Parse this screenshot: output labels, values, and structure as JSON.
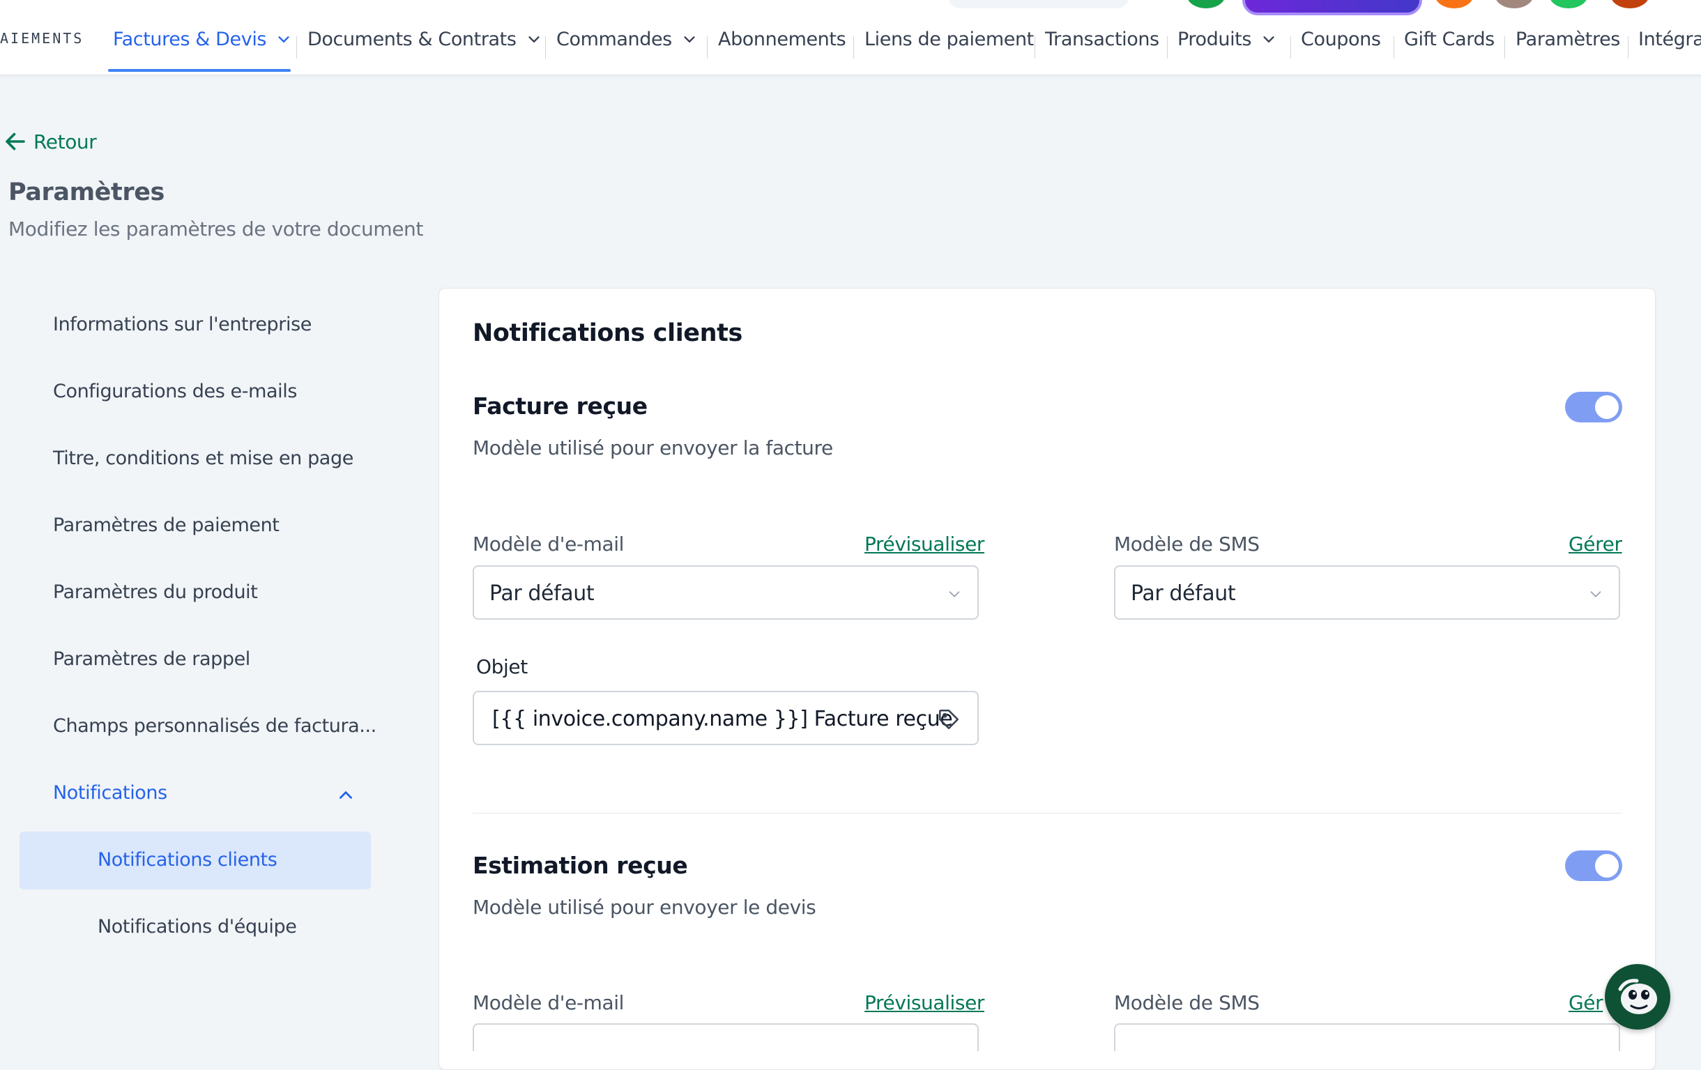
{
  "brand": "AIEMENTS",
  "nav": {
    "items": [
      {
        "label": "Factures & Devis"
      },
      {
        "label": "Documents & Contrats"
      },
      {
        "label": "Commandes"
      },
      {
        "label": "Abonnements"
      },
      {
        "label": "Liens de paiement"
      },
      {
        "label": "Transactions"
      },
      {
        "label": "Produits"
      },
      {
        "label": "Coupons"
      },
      {
        "label": "Gift Cards"
      },
      {
        "label": "Paramètres"
      },
      {
        "label": "Intégra"
      }
    ],
    "accent_color": "#2563eb"
  },
  "back_label": "Retour",
  "page": {
    "title": "Paramètres",
    "subtitle": "Modifiez les paramètres de votre document"
  },
  "sidebar": {
    "items": [
      {
        "label": "Informations sur l'entreprise"
      },
      {
        "label": "Configurations des e-mails"
      },
      {
        "label": "Titre, conditions et mise en page"
      },
      {
        "label": "Paramètres de paiement"
      },
      {
        "label": "Paramètres du produit"
      },
      {
        "label": "Paramètres de rappel"
      },
      {
        "label": "Champs personnalisés de factura..."
      },
      {
        "label": "Notifications"
      }
    ],
    "subitems": [
      {
        "label": "Notifications clients",
        "active": true
      },
      {
        "label": "Notifications d'équipe",
        "active": false
      }
    ]
  },
  "card": {
    "title": "Notifications clients",
    "sections": [
      {
        "title": "Facture reçue",
        "description": "Modèle utilisé pour envoyer la facture",
        "enabled": true,
        "email_label": "Modèle d'e-mail",
        "email_link": "Prévisualiser",
        "email_value": "Par défaut",
        "sms_label": "Modèle de SMS",
        "sms_link": "Gérer",
        "sms_value": "Par défaut",
        "subject_label": "Objet",
        "subject_value": "[{{ invoice.company.name }}] Facture reçue"
      },
      {
        "title": "Estimation reçue",
        "description": "Modèle utilisé pour envoyer le devis",
        "enabled": true,
        "email_label": "Modèle d'e-mail",
        "email_link": "Prévisualiser",
        "sms_label": "Modèle de SMS",
        "sms_link": "Gér"
      }
    ]
  },
  "colors": {
    "toggle_on": "#7f9ef3",
    "link": "#047857",
    "active_bg": "#dbe7fb"
  }
}
